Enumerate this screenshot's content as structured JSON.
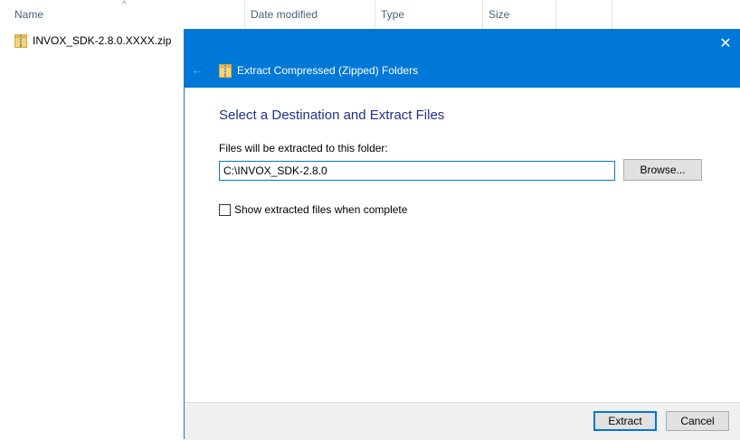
{
  "explorer": {
    "columns": {
      "name": "Name",
      "date_modified": "Date modified",
      "type": "Type",
      "size": "Size"
    },
    "files": [
      {
        "name": "INVOX_SDK-2.8.0.XXXX.zip",
        "icon": "zip-folder-icon"
      }
    ]
  },
  "dialog": {
    "title": "Extract Compressed (Zipped) Folders",
    "close_glyph": "✕",
    "back_glyph": "←",
    "heading": "Select a Destination and Extract Files",
    "destination_label": "Files will be extracted to this folder:",
    "destination_value": "C:\\INVOX_SDK-2.8.0",
    "browse_label": "Browse...",
    "show_files_label": "Show extracted files when complete",
    "show_files_checked": false,
    "extract_label": "Extract",
    "cancel_label": "Cancel"
  },
  "colors": {
    "titlebar": "#0078d7",
    "heading": "#1e3287",
    "footer": "#f0f0f0"
  }
}
